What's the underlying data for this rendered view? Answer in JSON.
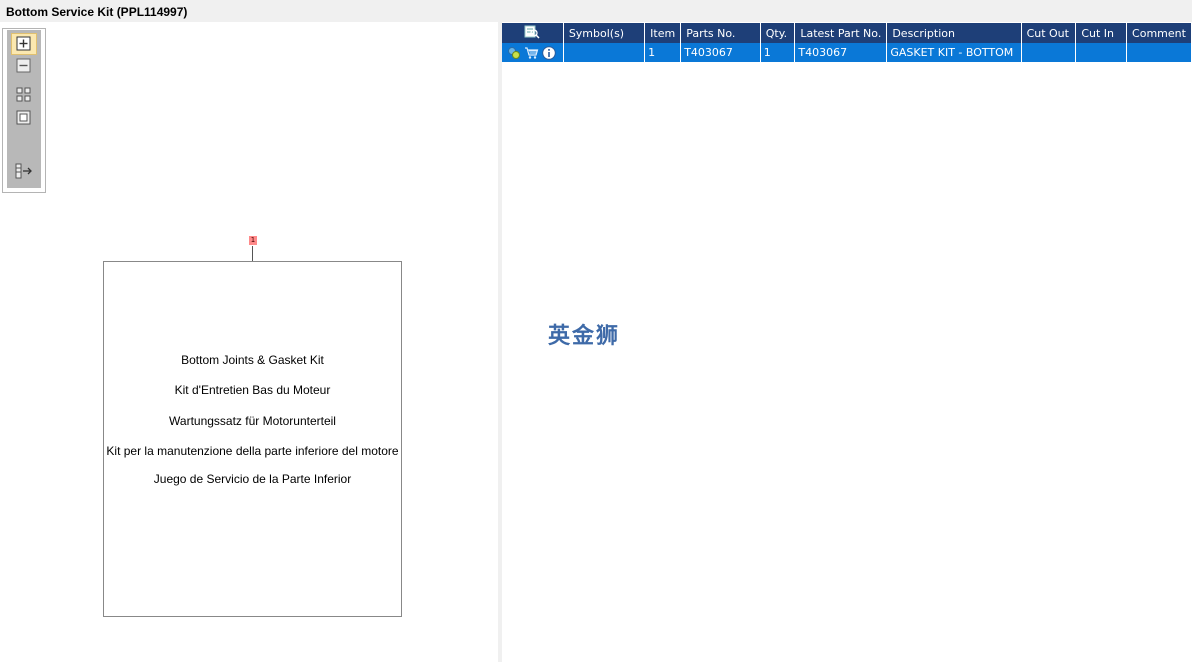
{
  "window": {
    "title": "Bottom Service Kit (PPL114997)"
  },
  "toolbar": {
    "tools": [
      {
        "name": "zoom-in-icon",
        "active": true
      },
      {
        "name": "zoom-out-icon",
        "active": false
      },
      {
        "name": "fit-all-icon",
        "active": false
      },
      {
        "name": "actual-size-icon",
        "active": false
      },
      {
        "name": "toggle-list-icon",
        "active": false
      }
    ]
  },
  "drawing": {
    "callout": "1",
    "lines": [
      "Bottom Joints & Gasket Kit",
      "Kit d'Entretien Bas du Moteur",
      "Wartungssatz für Motorunterteil",
      "Kit per la manutenzione della parte inferiore del motore",
      "Juego de Servicio de la Parte Inferior"
    ]
  },
  "table": {
    "header_icon": "search-list-icon",
    "columns": [
      "Symbol(s)",
      "Item",
      "Parts No.",
      "Qty.",
      "Latest Part No.",
      "Description",
      "Cut Out",
      "Cut In",
      "Comment"
    ],
    "rows": [
      {
        "icons": [
          "part-status-icon",
          "cart-icon",
          "info-icon"
        ],
        "symbols": "",
        "item": "1",
        "parts_no": "T403067",
        "qty": "1",
        "latest_part_no": "T403067",
        "description": "GASKET KIT - BOTTOM",
        "cut_out": "",
        "cut_in": "",
        "comment": ""
      }
    ]
  },
  "watermark": "英金狮",
  "colors": {
    "header_bg": "#1e3f78",
    "row_selected_bg": "#0a78d7",
    "callout_bg": "#ff8a8a",
    "watermark": "#3e6aa8"
  }
}
